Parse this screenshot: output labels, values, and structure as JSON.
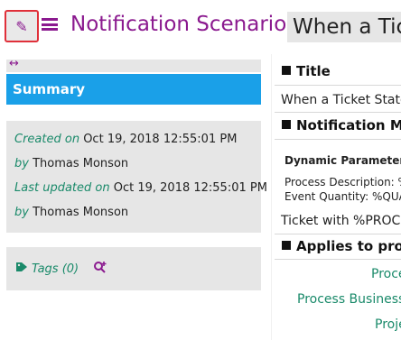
{
  "header": {
    "edit_icon": "pencil-icon",
    "menu_icon": "hamburger-menu-icon",
    "title": "Notification Scenarios",
    "subtitle": "When a Tick"
  },
  "left": {
    "resize_icon": "↔",
    "summary_tab": "Summary",
    "created_label": "Created on",
    "created_value": "Oct 19, 2018 12:55:01 PM",
    "by_label": "by",
    "created_by": "Thomas Monson",
    "updated_label": "Last updated on",
    "updated_value": "Oct 19, 2018 12:55:01 PM",
    "updated_by_label": "by",
    "updated_by": "Thomas Monson",
    "tags_label": "Tags (0)"
  },
  "right": {
    "title_heading": "Title",
    "title_value": "When a Ticket State",
    "notification_heading": "Notification Mes",
    "dynamic_heading": "Dynamic Parameters",
    "dynamic_line1": "Process Description: %",
    "dynamic_line2": "Event Quantity: %QUA",
    "message_value": "Ticket with %PROCE",
    "applies_heading": "Applies to proce",
    "links": [
      "Proce",
      "Process Business I",
      "Proje"
    ]
  },
  "colors": {
    "accent": "#8b1a8f",
    "summary_blue": "#1aa0e8",
    "label_green": "#1a8a6a",
    "panel_gray": "#e6e6e6",
    "edit_border": "#e0303a"
  }
}
